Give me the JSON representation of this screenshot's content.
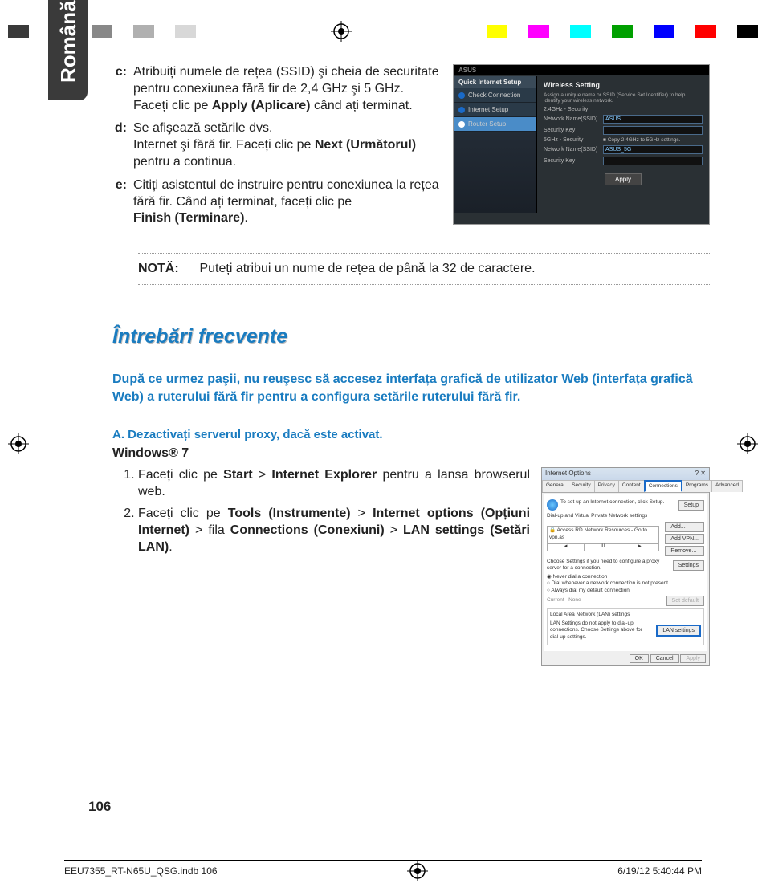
{
  "registrationColorsLeft": [
    "#3a3a3a",
    "#ffffff",
    "#5a5a5a",
    "#ffffff",
    "#888888",
    "#ffffff",
    "#b0b0b0",
    "#ffffff",
    "#d8d8d8"
  ],
  "registrationColorsRight": [
    "#ffff00",
    "#ffffff",
    "#ff00ff",
    "#ffffff",
    "#00ffff",
    "#ffffff",
    "#00a000",
    "#ffffff",
    "#0000ff",
    "#ffffff",
    "#ff0000",
    "#ffffff",
    "#000000"
  ],
  "langTab": "Română",
  "steps": {
    "c": {
      "label": "c:",
      "t1": "Atribuiți numele de rețea (SSID) şi cheia de securitate pentru conexiunea fără fir de 2,4 GHz şi 5 GHz. Faceți clic pe ",
      "bold1": "Apply (Aplicare)",
      "t2": " când ați terminat."
    },
    "d": {
      "label": "d:",
      "t1": "Se afişează setările dvs.",
      "t2": "Internet şi fără fir. Faceți clic pe ",
      "bold1": "Next (Următorul)",
      "t3": " pentru a continua."
    },
    "e": {
      "label": "e:",
      "t1": "Citiți asistentul de instruire pentru conexiunea la rețea fără fir. Când ați terminat, faceți clic pe",
      "bold1": "Finish (Terminare)",
      "t2": "."
    }
  },
  "router": {
    "brand": "ASUS",
    "sideHdr": "Quick Internet Setup",
    "side1": "Check Connection",
    "side2": "Internet Setup",
    "side3": "Router Setup",
    "title": "Wireless Setting",
    "desc": "Assign a unique name or SSID (Service Set Identifier) to help identify your wireless network.",
    "r1": "2.4GHz - Security",
    "r2l": "Network Name(SSID)",
    "r2v": "ASUS",
    "r3l": "Security Key",
    "r3v": "",
    "r4": "5GHz - Security",
    "r4c": "Copy 2.4GHz to 5GHz settings.",
    "r5l": "Network Name(SSID)",
    "r5v": "ASUS_5G",
    "r6l": "Security Key",
    "r6v": "",
    "apply": "Apply"
  },
  "note": {
    "label": "NOTĂ:",
    "text": "Puteți atribui un nume de rețea de până la 32 de caractere."
  },
  "faqHeading": "Întrebări frecvente",
  "faqLead": "După ce urmez paşii, nu reuşesc să accesez interfața grafică de utilizator Web (interfața grafică Web) a ruterului fără fir pentru a configura setările ruterului fără fir.",
  "subA": "A. Dezactivați serverul proxy, dacă este activat.",
  "win7": "Windows® 7",
  "ol": {
    "1": {
      "t1": "Faceți clic pe ",
      "b1": "Start",
      "sep": " > ",
      "b2": "Internet Explorer",
      "t2": " pentru a lansa browserul web."
    },
    "2": {
      "t1": "Faceți clic pe ",
      "b1": "Tools (Instrumente)",
      "t2": " > ",
      "b2": "Internet options (Opțiuni Internet)",
      "t3": " > fila ",
      "b3": "Connections (Conexiuni)",
      "t4": " > ",
      "b4": "LAN settings (Setări LAN)",
      "t5": "."
    }
  },
  "ie": {
    "title": "Internet Options",
    "tabs": [
      "General",
      "Security",
      "Privacy",
      "Content",
      "Connections",
      "Programs",
      "Advanced"
    ],
    "setupText": "To set up an Internet connection, click Setup.",
    "setup": "Setup",
    "dialHdr": "Dial-up and Virtual Private Network settings",
    "listItem": "Access RD Network Resources - Go to vpn.as",
    "add": "Add...",
    "addVpn": "Add VPN...",
    "remove": "Remove...",
    "scroll": [
      "◄",
      "III",
      "►"
    ],
    "chooseTxt": "Choose Settings if you need to configure a proxy server for a connection.",
    "settings": "Settings",
    "opt1": "Never dial a connection",
    "opt2": "Dial whenever a network connection is not present",
    "opt3": "Always dial my default connection",
    "curLbl": "Current",
    "curVal": "None",
    "setDef": "Set default",
    "lanHdr": "Local Area Network (LAN) settings",
    "lanTxt": "LAN Settings do not apply to dial-up connections. Choose Settings above for dial-up settings.",
    "lanBtn": "LAN settings",
    "ok": "OK",
    "cancel": "Cancel",
    "applyBtn": "Apply"
  },
  "pageNumber": "106",
  "footerLeft": "EEU7355_RT-N65U_QSG.indb   106",
  "footerRight": "6/19/12   5:40:44 PM"
}
